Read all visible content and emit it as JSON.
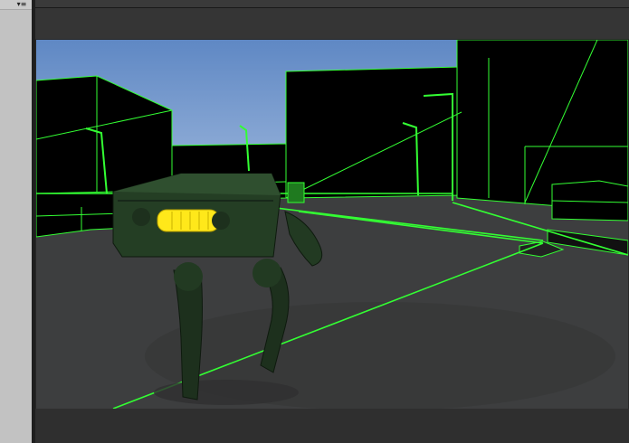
{
  "editor": {
    "panel_menu_icon": "▾≡",
    "viewport_view": "scene-3d",
    "wireframe_color": "#33ff33",
    "sky_color": "#6f93c9",
    "ground_color": "#3d3e3f",
    "robot_color": "#2a4a2a",
    "highlight_color": "#ffe81a"
  }
}
